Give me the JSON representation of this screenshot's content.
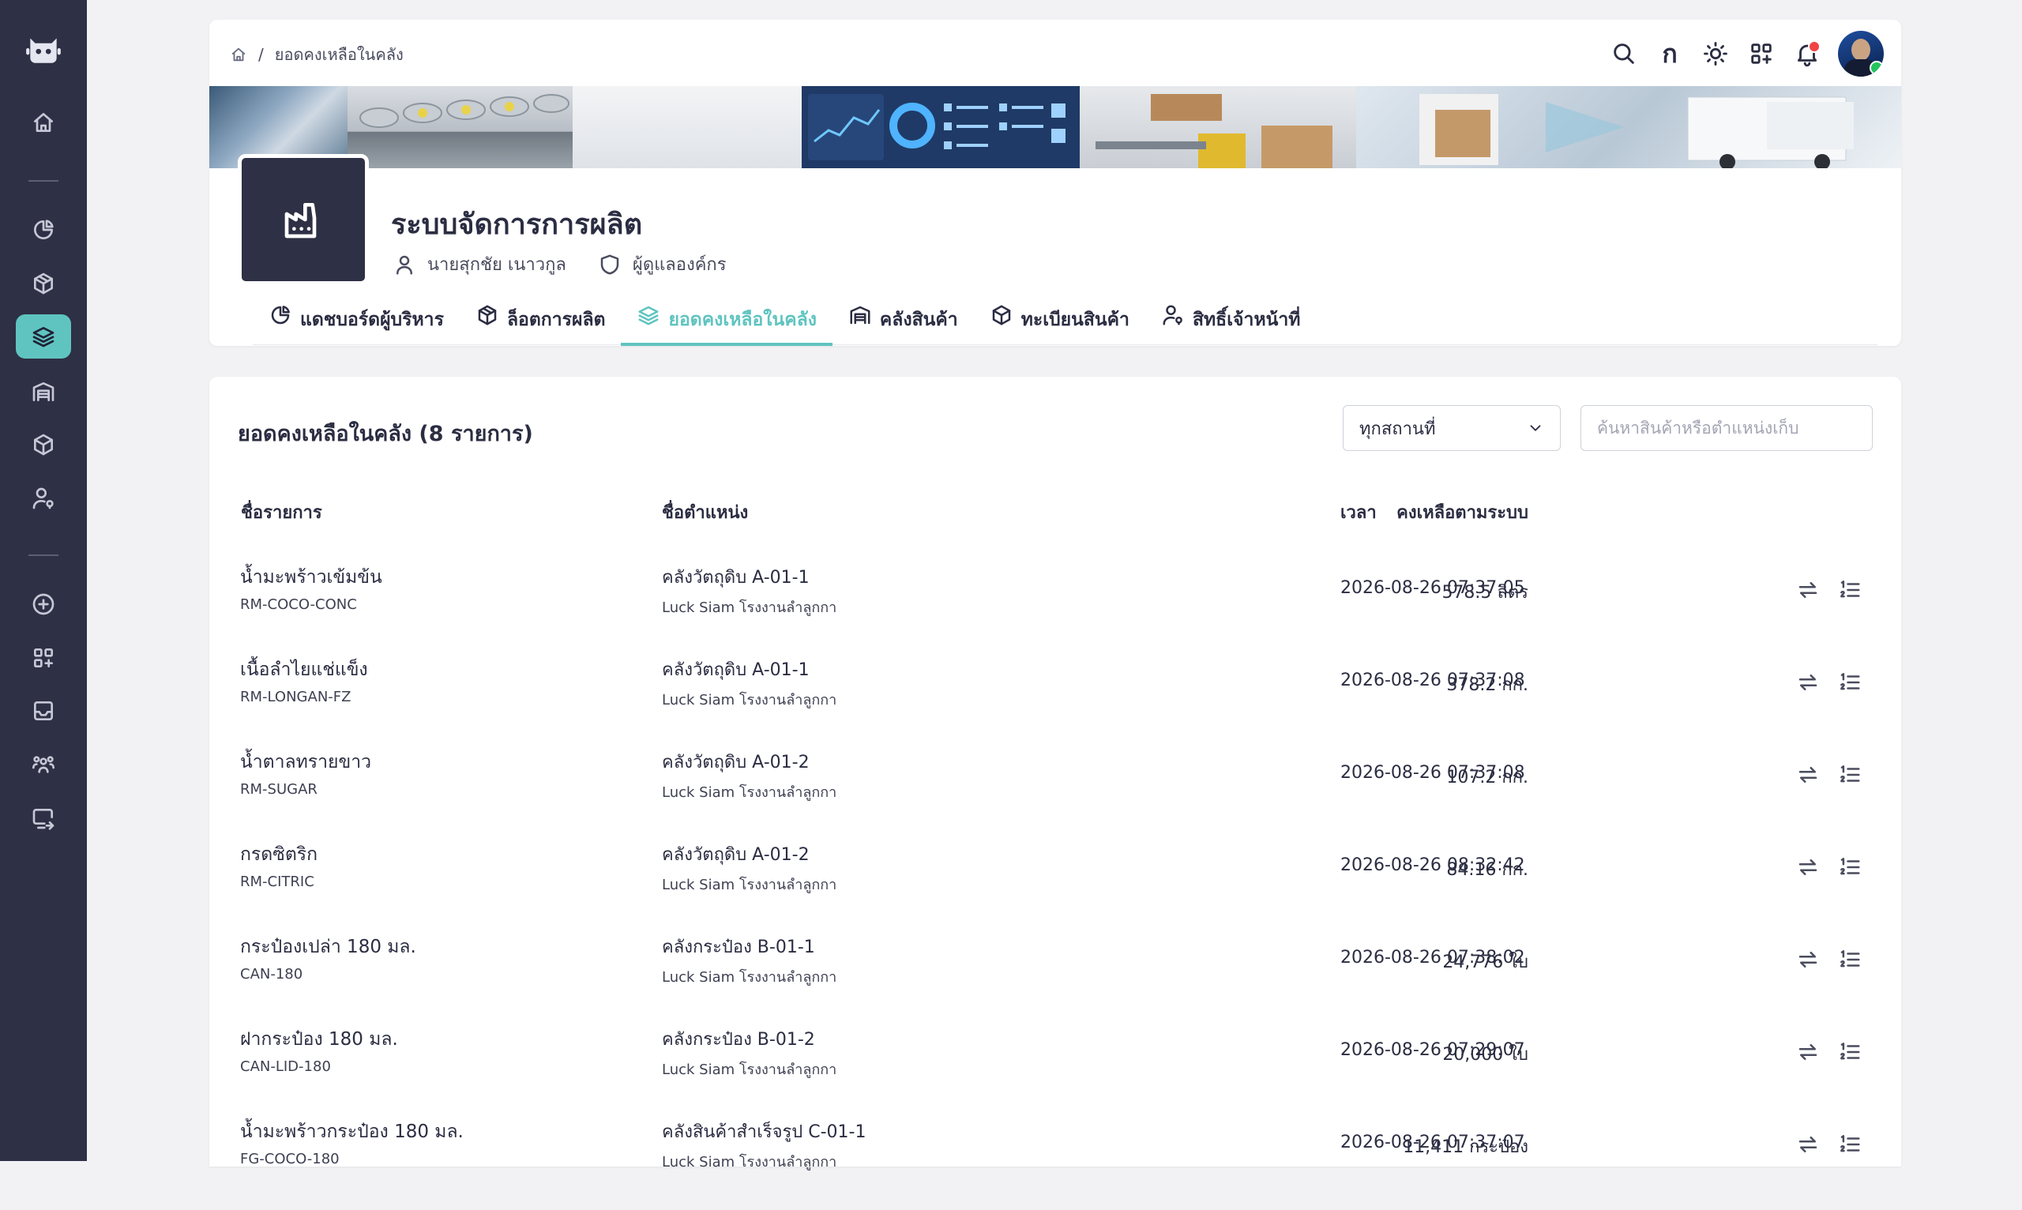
{
  "breadcrumb": {
    "separator": "/",
    "current": "ยอดคงเหลือในคลัง"
  },
  "topbar": {
    "language_glyph": "ก",
    "icons": [
      "search-icon",
      "language-icon",
      "theme-sun-icon",
      "apps-icon",
      "bell-icon",
      "avatar"
    ]
  },
  "sidebar": {
    "icons": [
      "robot-logo-icon",
      "home-icon",
      "chart-pie-icon",
      "box-icon",
      "layers-icon",
      "warehouse-icon",
      "cube-icon",
      "user-lock-icon",
      "plus-circle-icon",
      "apps-add-icon",
      "inbox-icon",
      "users-icon",
      "screen-share-icon"
    ],
    "active": "layers-icon"
  },
  "app": {
    "title": "ระบบจัดการการผลิต",
    "user_name": "นายสุกชัย เนาวกูล",
    "role": "ผู้ดูแลองค์กร"
  },
  "tabs": [
    {
      "label": "แดชบอร์ดผู้บริหาร",
      "icon": "chart-pie-icon"
    },
    {
      "label": "ล็อตการผลิต",
      "icon": "box-icon"
    },
    {
      "label": "ยอดคงเหลือในคลัง",
      "icon": "layers-icon"
    },
    {
      "label": "คลังสินค้า",
      "icon": "warehouse-icon"
    },
    {
      "label": "ทะเบียนสินค้า",
      "icon": "cube-icon"
    },
    {
      "label": "สิทธิ์เจ้าหน้าที่",
      "icon": "user-lock-icon"
    }
  ],
  "active_tab": "ยอดคงเหลือในคลัง",
  "inventory": {
    "title": "ยอดคงเหลือในคลัง (8 รายการ)",
    "filter_value": "ทุกสถานที่",
    "search_placeholder": "ค้นหาสินค้าหรือตำแหน่งเก็บ",
    "columns": {
      "item": "ชื่อรายการ",
      "location": "ชื่อตำแหน่ง",
      "qty": "คงเหลือตามระบบ",
      "time": "เวลา"
    },
    "rows": [
      {
        "name": "น้ำมะพร้าวเข้มข้น",
        "code": "RM-COCO-CONC",
        "location": "คลังวัตถุดิบ A-01-1",
        "site": "Luck Siam โรงงานลำลูกกา",
        "qty": "578.5 ลิตร",
        "time": "2026-08-26 07:37:05"
      },
      {
        "name": "เนื้อลำไยแช่แข็ง",
        "code": "RM-LONGAN-FZ",
        "location": "คลังวัตถุดิบ A-01-1",
        "site": "Luck Siam โรงงานลำลูกกา",
        "qty": "378.2 กก.",
        "time": "2026-08-26 07:37:08"
      },
      {
        "name": "น้ำตาลทรายขาว",
        "code": "RM-SUGAR",
        "location": "คลังวัตถุดิบ A-01-2",
        "site": "Luck Siam โรงงานลำลูกกา",
        "qty": "107.2 กก.",
        "time": "2026-08-26 07:37:08"
      },
      {
        "name": "กรดซิตริก",
        "code": "RM-CITRIC",
        "location": "คลังวัตถุดิบ A-01-2",
        "site": "Luck Siam โรงงานลำลูกกา",
        "qty": "84.16 กก.",
        "time": "2026-08-26 08:32:42"
      },
      {
        "name": "กระป๋องเปล่า 180 มล.",
        "code": "CAN-180",
        "location": "คลังกระป๋อง B-01-1",
        "site": "Luck Siam โรงงานลำลูกกา",
        "qty": "24,776 ใบ",
        "time": "2026-08-26 07:38:02"
      },
      {
        "name": "ฝากระป๋อง 180 มล.",
        "code": "CAN-LID-180",
        "location": "คลังกระป๋อง B-01-2",
        "site": "Luck Siam โรงงานลำลูกกา",
        "qty": "20,000 ใบ",
        "time": "2026-08-26 07:29:07"
      },
      {
        "name": "น้ำมะพร้าวกระป๋อง 180 มล.",
        "code": "FG-COCO-180",
        "location": "คลังสินค้าสำเร็จรูป C-01-1",
        "site": "Luck Siam โรงงานลำลูกกา",
        "qty": "11,411 กระป๋อง",
        "time": "2026-08-26 07:37:07"
      }
    ]
  },
  "colors": {
    "sidebar": "#2e3045",
    "accent": "#5fc4c0",
    "background": "#f2f2f5",
    "notification": "#ef4444"
  }
}
